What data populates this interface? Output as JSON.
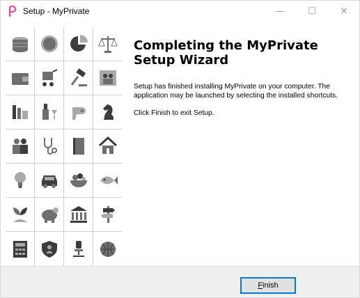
{
  "window": {
    "title": "Setup - MyPrivate",
    "controls": {
      "minimize": "—",
      "maximize": "☐",
      "close": "✕"
    }
  },
  "side_grid": {
    "icons": [
      "coins-icon",
      "coin-icon",
      "pie-chart-icon",
      "scales-icon",
      "wallet-icon",
      "stroller-icon",
      "gavel-icon",
      "family-picture-icon",
      "factory-icon",
      "wine-icon",
      "hair-dryer-icon",
      "chess-knight-icon",
      "parents-icon",
      "stethoscope-icon",
      "notebook-icon",
      "house-icon",
      "light-bulb-icon",
      "car-icon",
      "food-bowl-icon",
      "fish-icon",
      "plant-icon",
      "piggy-bank-icon",
      "bank-icon",
      "signpost-icon",
      "calculator-icon",
      "shield-person-icon",
      "office-chair-icon",
      "basketball-icon"
    ]
  },
  "content": {
    "heading": "Completing the MyPrivate Setup Wizard",
    "paragraph1": "Setup has finished installing MyPrivate on your computer. The application may be launched by selecting the installed shortcuts.",
    "paragraph2": "Click Finish to exit Setup."
  },
  "buttons": {
    "finish_mnemonic": "F",
    "finish_rest": "inish"
  },
  "colors": {
    "focus_border": "#0078d7",
    "button_face": "#e1e1e1",
    "footer_bg": "#f0f0f0",
    "icon_gray": "#6e6e6e",
    "app_icon": "#e64a8b"
  }
}
